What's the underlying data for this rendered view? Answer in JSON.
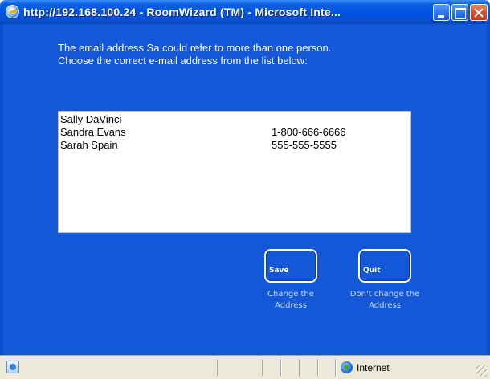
{
  "window": {
    "title": "http://192.168.100.24 - RoomWizard (TM) - Microsoft Inte...",
    "buttons": [
      "minimize",
      "maximize",
      "close"
    ]
  },
  "dialog": {
    "line1": "The email address Sa could refer to more than one person.",
    "line2": "Choose the correct e-mail address from the list below:"
  },
  "list": [
    {
      "name": "Sally DaVinci",
      "phone": ""
    },
    {
      "name": "Sandra Evans",
      "phone": "1-800-666-6666"
    },
    {
      "name": "Sarah Spain",
      "phone": "555-555-5555"
    }
  ],
  "actions": {
    "save_label": "Save",
    "save_caption_line1": "Change the",
    "save_caption_line2": "Address",
    "quit_label": "Quit",
    "quit_caption_line1": "Don't change the",
    "quit_caption_line2": "Address"
  },
  "statusbar": {
    "status_text": "",
    "zone_label": "Internet"
  },
  "icons": {
    "title": "ie-page-icon",
    "status": "page-icon",
    "zone": "internet-globe-icon"
  },
  "colors": {
    "background": "#1458d8",
    "titlebar": "#0054e3",
    "close_button": "#d2502a",
    "statusbar": "#ece9d8"
  }
}
